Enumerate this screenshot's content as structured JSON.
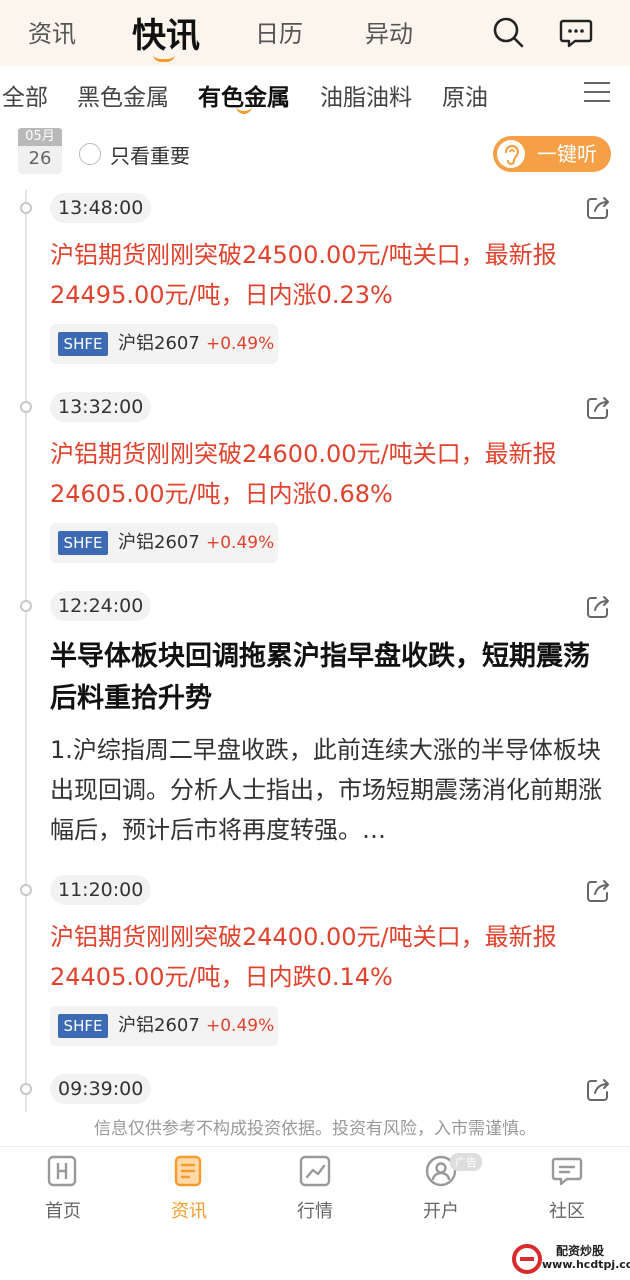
{
  "top_tabs": [
    "资讯",
    "快讯",
    "日历",
    "异动"
  ],
  "categories": [
    "全部",
    "黑色金属",
    "有色金属",
    "油脂油料",
    "原油"
  ],
  "date": {
    "month": "05月",
    "day": "26"
  },
  "filter_label": "只看重要",
  "listen_button": "一键听",
  "items": [
    {
      "time": "13:48:00",
      "text": "沪铝期货刚刚突破24500.00元/吨关口，最新报24495.00元/吨，日内涨0.23%",
      "exchange": "SHFE",
      "contract": "沪铝2607",
      "change": "+0.49%"
    },
    {
      "time": "13:32:00",
      "text": "沪铝期货刚刚突破24600.00元/吨关口，最新报24605.00元/吨，日内涨0.68%",
      "exchange": "SHFE",
      "contract": "沪铝2607",
      "change": "+0.49%"
    },
    {
      "time": "12:24:00",
      "title": "半导体板块回调拖累沪指早盘收跌，短期震荡后料重拾升势",
      "body": "1.沪综指周二早盘收跌，此前连续大涨的半导体板块出现回调。分析人士指出，市场短期震荡消化前期涨幅后，预计后市将再度转强。…"
    },
    {
      "time": "11:20:00",
      "text": "沪铝期货刚刚突破24400.00元/吨关口，最新报24405.00元/吨，日内跌0.14%",
      "exchange": "SHFE",
      "contract": "沪铝2607",
      "change": "+0.49%"
    },
    {
      "time": "09:39:00"
    }
  ],
  "disclaimer": "信息仅供参考不构成投资依据。投资有风险，入市需谨慎。",
  "bottom_nav": [
    {
      "label": "首页",
      "icon": "home-icon"
    },
    {
      "label": "资讯",
      "icon": "news-icon"
    },
    {
      "label": "行情",
      "icon": "chart-icon"
    },
    {
      "label": "开户",
      "icon": "account-icon",
      "badge": "广告"
    },
    {
      "label": "社区",
      "icon": "community-icon"
    }
  ],
  "watermark": {
    "name": "配资炒股",
    "url": "www.hcdtpj.com"
  },
  "colors": {
    "accent": "#f59b2e",
    "up": "#e0422d",
    "exchange_badge": "#3c6bb4"
  }
}
